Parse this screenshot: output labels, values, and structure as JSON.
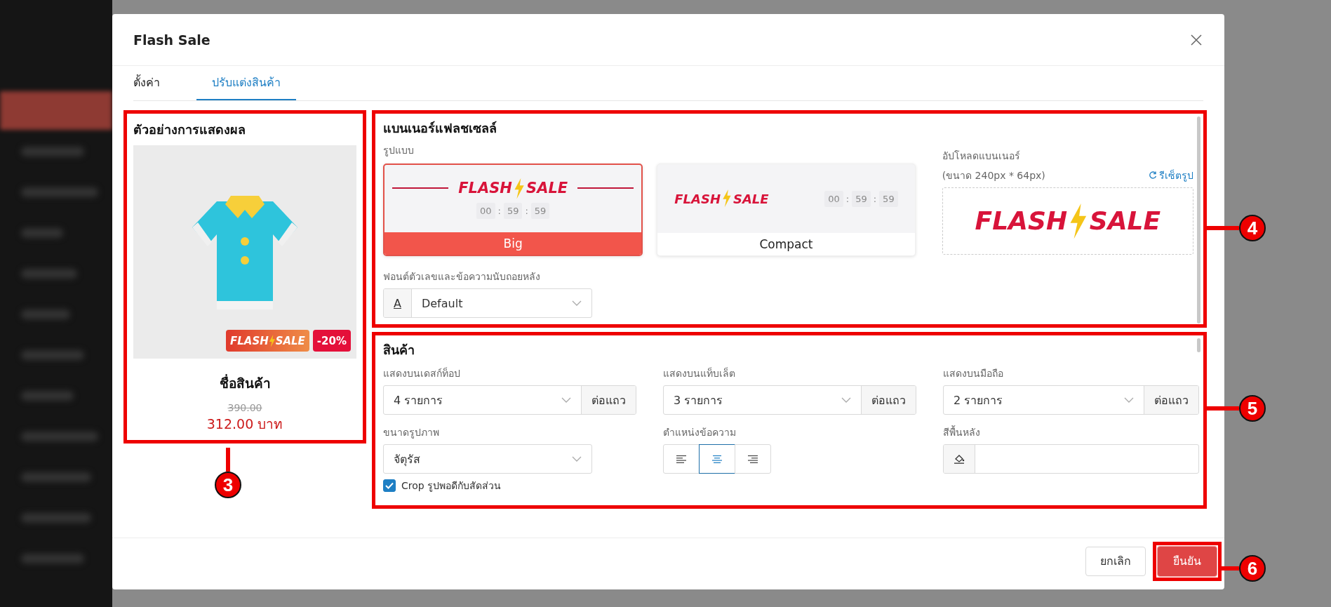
{
  "modal": {
    "title": "Flash Sale"
  },
  "tabs": [
    {
      "label": "ตั้งค่า",
      "selected": false
    },
    {
      "label": "ปรับแต่งสินค้า",
      "selected": true
    }
  ],
  "preview": {
    "heading": "ตัวอย่างการแสดงผล",
    "badge_words": [
      "FLASH",
      "SALE"
    ],
    "discount": "-20%",
    "product_name": "ชื่อสินค้า",
    "original_price": "390.00",
    "price": "312.00 บาท"
  },
  "banner": {
    "heading": "แบนเนอร์แฟลชเซลล์",
    "style_label": "รูปแบบ",
    "timer_separator": ":",
    "styles": [
      {
        "name": "Big",
        "kind": "big",
        "selected": true,
        "words": [
          "FLASH",
          "SALE"
        ],
        "timer": [
          "00",
          "59",
          "59"
        ]
      },
      {
        "name": "Compact",
        "kind": "compact",
        "selected": false,
        "words": [
          "FLASH",
          "SALE"
        ],
        "timer": [
          "00",
          "59",
          "59"
        ]
      }
    ],
    "upload_label": "อัปโหลดแบนเนอร์",
    "upload_hint": "(ขนาด 240px * 64px)",
    "reset_link": "รีเซ็ตรูป",
    "upload_words": [
      "FLASH",
      "SALE"
    ],
    "font_label": "ฟอนต์ตัวเลขและข้อความนับถอยหลัง",
    "font_letter": "A",
    "font_value": "Default"
  },
  "products": {
    "heading": "สินค้า",
    "displays": [
      {
        "label": "แสดงบนเดสก์ท็อป",
        "value": "4 รายการ",
        "suffix": "ต่อแถว"
      },
      {
        "label": "แสดงบนแท็บเล็ต",
        "value": "3 รายการ",
        "suffix": "ต่อแถว"
      },
      {
        "label": "แสดงบนมือถือ",
        "value": "2 รายการ",
        "suffix": "ต่อแถว"
      }
    ],
    "image_size": {
      "label": "ขนาดรูปภาพ",
      "value": "จัตุรัส"
    },
    "text_position": {
      "label": "ตำแหน่งข้อความ",
      "options": [
        {
          "kind": "left",
          "selected": false
        },
        {
          "kind": "center",
          "selected": true
        },
        {
          "kind": "right",
          "selected": false
        }
      ]
    },
    "background": {
      "label": "สีพื้นหลัง"
    },
    "crop": {
      "label": "Crop รูปพอดีกับสัดส่วน",
      "checked": true
    }
  },
  "footer": {
    "cancel": "ยกเลิก",
    "confirm": "ยืนยัน"
  },
  "callouts": [
    {
      "number": "3"
    },
    {
      "number": "4"
    },
    {
      "number": "5"
    },
    {
      "number": "6"
    }
  ]
}
